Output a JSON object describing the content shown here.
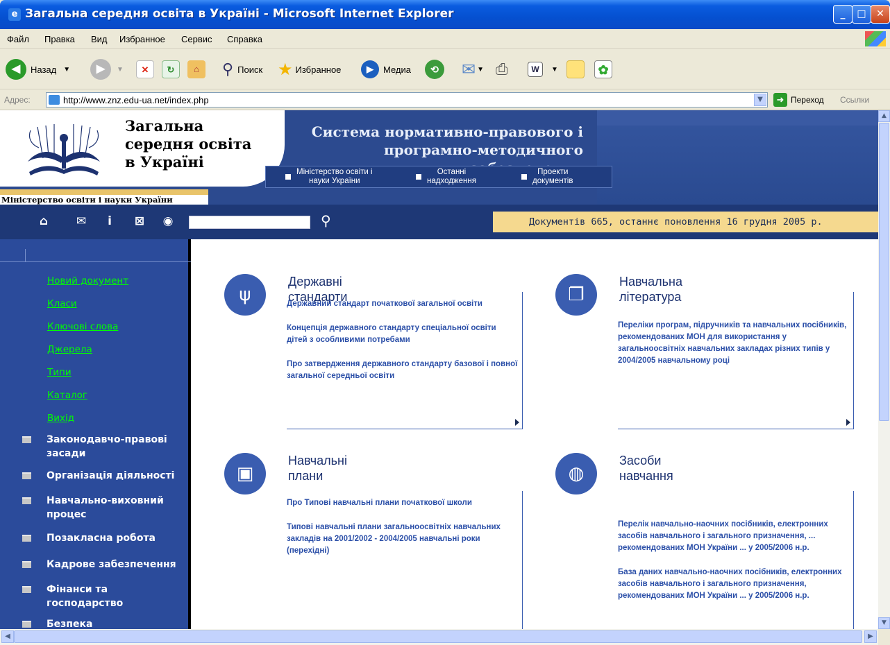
{
  "window": {
    "title": "Загальна середня освіта в Україні - Microsoft Internet Explorer",
    "btn_min": "_",
    "btn_max": "□",
    "btn_close": "✕"
  },
  "menu": [
    "Файл",
    "Правка",
    "Вид",
    "Избранное",
    "Сервис",
    "Справка"
  ],
  "toolbar": {
    "back": "Назад",
    "search": "Поиск",
    "favorites": "Избранное",
    "media": "Медиа"
  },
  "address": {
    "label": "Адрес:",
    "url": "http://www.znz.edu-ua.net/index.php",
    "go": "Переход",
    "links": "Ссылки"
  },
  "header": {
    "logo_line1": "Загальна",
    "logo_line2": "середня освіта",
    "logo_line3": "в Україні",
    "ministry": "Міністерство освіти і науки України",
    "system_line1": "Система нормативно-правового і",
    "system_line2": "програмно-методичного забезпечення",
    "nav": [
      {
        "line1": "Міністерство освіти і",
        "line2": "науки України"
      },
      {
        "line1": "Останні",
        "line2": "надходження"
      },
      {
        "line1": "Проекти",
        "line2": "документів"
      }
    ]
  },
  "searchbar": {
    "status": "Документів 665, останнє поновлення 16 грудня 2005 р.",
    "icons": [
      "home-icon",
      "mail-icon",
      "info-icon",
      "sitemap-icon",
      "globe-icon"
    ]
  },
  "sidebar": {
    "links": [
      "Новий документ",
      "Класи",
      "Ключові слова",
      "Джерела",
      "Типи",
      "Каталог",
      "Вихід"
    ],
    "categories": [
      {
        "line1": "Законодавчо-правові",
        "line2": "засади"
      },
      {
        "line1": "Організація діяльності",
        "line2": ""
      },
      {
        "line1": "Навчально-виховний",
        "line2": "процес"
      },
      {
        "line1": "Позакласна робота",
        "line2": ""
      },
      {
        "line1": "Кадрове забезпечення",
        "line2": ""
      },
      {
        "line1": "Фінанси та",
        "line2": "господарство"
      },
      {
        "line1": "Безпека",
        "line2": ""
      }
    ]
  },
  "cards": [
    {
      "title": "Державні стандарти",
      "icon": "trident-icon",
      "links": [
        "Державний стандарт початкової загальної освіти",
        "Концепція державного стандарту спеціальної освіти дітей з особливими потребами",
        "Про затвердження державного стандарту базової і повної загальної середньої освіти"
      ]
    },
    {
      "title": "Навчальна література",
      "icon": "book-icon",
      "links": [
        "Переліки програм, підручників та навчальних посібників, рекомендованих МОН для використання у загальноосвітніх навчальних закладах різних типів у 2004/2005 навчальному році"
      ]
    },
    {
      "title": "Навчальні плани",
      "icon": "briefcase-icon",
      "links": [
        "Про Типові навчальні плани початкової школи",
        "Типові навчальні плани загальноосвітніх навчальних закладів на 2001/2002 - 2004/2005 навчальні роки (перехідні)"
      ]
    },
    {
      "title": "Засоби навчання",
      "icon": "globe-icon",
      "links": [
        "Перелік навчально-наочних посібників, електронних засобів навчального і загального призначення, ... рекомендованих МОН України ... у 2005/2006 н.р.",
        "База даних навчально-наочних посібників, електронних засобів навчального і загального призначення, рекомендованих МОН України ... у 2005/2006 н.р."
      ]
    }
  ]
}
